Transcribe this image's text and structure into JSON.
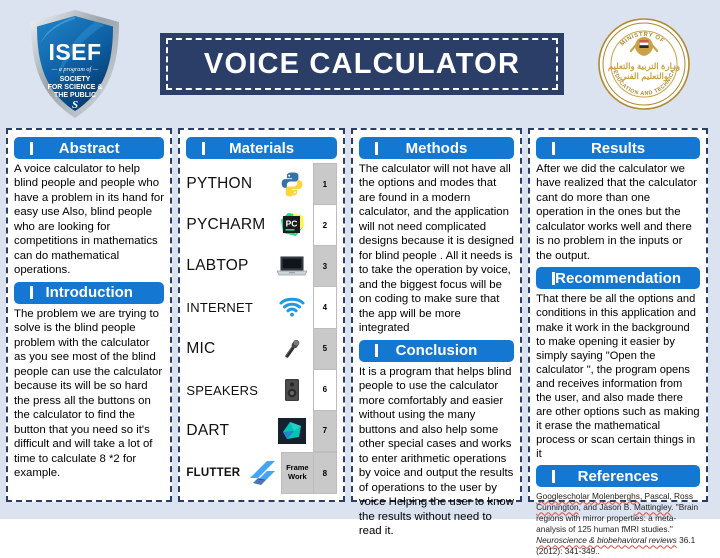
{
  "poster": {
    "title": "VOICE CALCULATOR",
    "logo_left": {
      "name": "ISEF",
      "line1": "— a program of —",
      "line2": "SOCIETY",
      "line3": "FOR SCIENCE &",
      "line4": "THE PUBLIC"
    },
    "logo_right": {
      "name": "Ministry of Education and Technical Education seal",
      "ring_top": "MINISTRY OF",
      "ring_bottom": "EDUCATION AND TECHNICAL EDUCATION"
    },
    "colors": {
      "background": "#dbe2f0",
      "banner": "#2b3e68",
      "section_header": "#1477d1",
      "panel_border": "#2b3e68"
    }
  },
  "sections": {
    "abstract": {
      "heading": "Abstract",
      "text": "A voice calculator to help blind people and people who have a problem in its hand for easy use  Also, blind people who are looking for competitions in mathematics can do mathematical operations."
    },
    "introduction": {
      "heading": "Introduction",
      "text": "The problem we are trying to solve is the blind people problem with the calculator as you see most of the blind people can use the calculator because its will be so hard the press all the buttons on the calculator to find the button that you need so it's difficult and will take a lot of time to calculate 8 *2 for example."
    },
    "materials": {
      "heading": "Materials",
      "framework_label": "Frame Work",
      "items": [
        {
          "num": "1",
          "label": "PYTHON",
          "icon": "python-icon"
        },
        {
          "num": "2",
          "label": "PYCHARM",
          "icon": "pycharm-icon"
        },
        {
          "num": "3",
          "label": "LABTOP",
          "icon": "laptop-icon"
        },
        {
          "num": "4",
          "label": "INTERNET",
          "icon": "wifi-icon"
        },
        {
          "num": "5",
          "label": "MIC",
          "icon": "microphone-icon"
        },
        {
          "num": "6",
          "label": "SPEAKERS",
          "icon": "speaker-icon"
        },
        {
          "num": "7",
          "label": "DART",
          "icon": "dart-icon"
        },
        {
          "num": "8",
          "label": "FLUTTER",
          "icon": "flutter-icon"
        }
      ]
    },
    "methods": {
      "heading": "Methods",
      "text": "The calculator will not have all the options and modes that are found in a modern calculator, and the application will not need complicated designs because it is designed for blind people . All it needs is to take the operation by voice, and the biggest focus will be on coding to make sure that the app will be more integrated"
    },
    "conclusion": {
      "heading": "Conclusion",
      "text": "It is a program that helps blind people to use the calculator more comfortably and easier without using the many buttons and also help some other special cases and works to enter arithmetic operations by voice and output the results of operations to the user by voice Helping the user to know the results without need to read it."
    },
    "results": {
      "heading": "Results",
      "text": "After we did the calculator we have realized that the calculator cant do more than one operation in the ones but the calculator works well and there is no problem in the inputs or the output."
    },
    "recommendation": {
      "heading": "Recommendation",
      "text": "That there be all the options and conditions in this application and make it work in the background to make opening it easier by simply saying \"Open the calculator \", the program opens and receives information from the user, and also made there are other options such as making it erase the mathematical process or scan certain things in it"
    },
    "references": {
      "heading": "References",
      "citation_parts": {
        "p1": "Googlescholar",
        "p2": " Molenberghs",
        "p3": ", Pascal, Ross ",
        "p4": "Cunnington",
        "p5": ", and Jason B. ",
        "p6": "Mattingley",
        "p7": ". \"Brain regions with mirror properties: a meta-analysis of 125 human fMRI studies.\" ",
        "p8": "Neuroscience & biobehavioral reviews",
        "p9": " 36.1 (2012): 341-349.."
      }
    }
  }
}
